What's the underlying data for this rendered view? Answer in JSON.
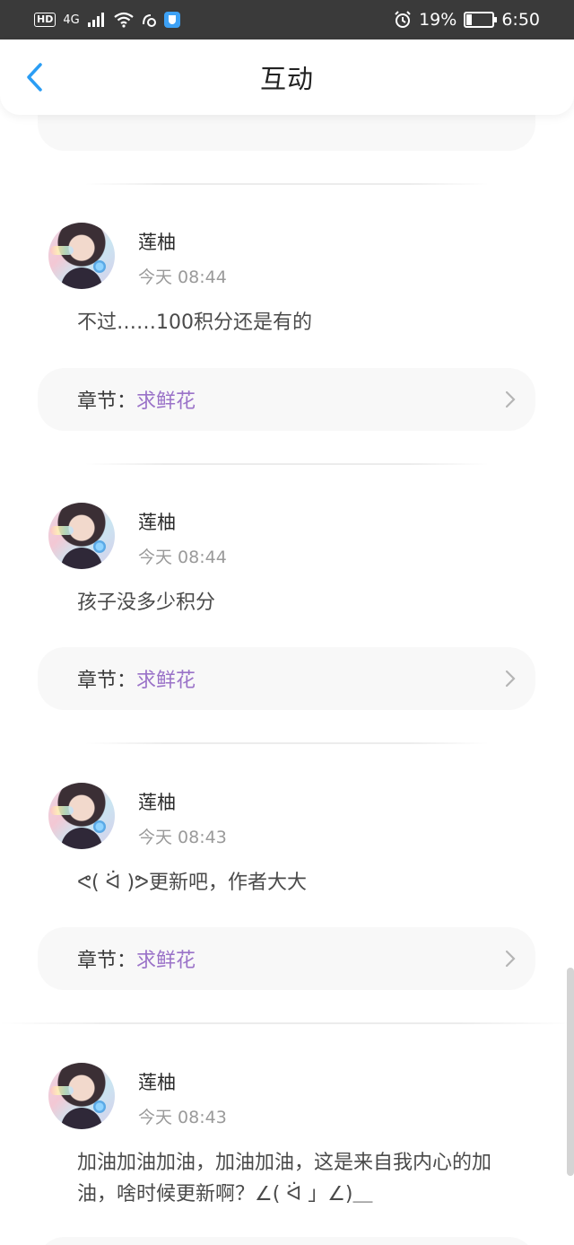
{
  "status_bar": {
    "hd": "HD",
    "network": "4G",
    "battery_percent": "19%",
    "time": "6:50",
    "battery_level": 0.19
  },
  "header": {
    "title": "互动",
    "back_icon": "chevron-left-icon",
    "accent_color": "#2a9df4"
  },
  "posts": [
    {
      "username": "莲柚",
      "time": "今天 08:44",
      "content": "不过……100积分还是有的",
      "chapter_label": "章节：",
      "chapter_name": "求鲜花"
    },
    {
      "username": "莲柚",
      "time": "今天 08:44",
      "content": "孩子没多少积分",
      "chapter_label": "章节：",
      "chapter_name": "求鲜花"
    },
    {
      "username": "莲柚",
      "time": "今天 08:43",
      "content": "ᕙ( ᐛ )ᕗ更新吧，作者大大",
      "chapter_label": "章节：",
      "chapter_name": "求鲜花"
    },
    {
      "username": "莲柚",
      "time": "今天 08:43",
      "content": "加油加油加油，加油加油，这是来自我内心的加油，啥时候更新啊？∠( ᐛ 」∠)＿"
    }
  ],
  "colors": {
    "chapter_name": "#9a72c8",
    "card_background": "#f8f8f8",
    "status_bar": "#3a3a3a"
  }
}
